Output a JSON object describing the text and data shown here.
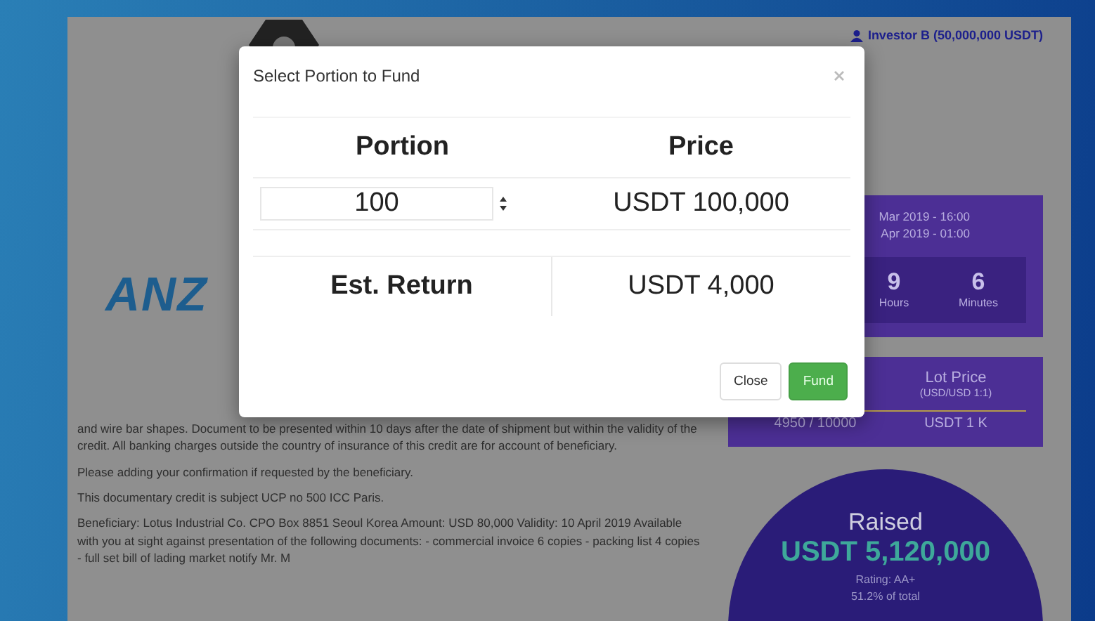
{
  "header": {
    "user": "Investor B (50,000,000 USDT)"
  },
  "logo": {
    "text": "ANZ"
  },
  "description": [
    "and wire bar shapes. Document to be presented within 10 days after the date of shipment but within the validity of the credit. All banking charges outside the country of insurance of this credit are for account of beneficiary.",
    "Please adding your confirmation if requested by the beneficiary.",
    "This documentary credit is subject UCP no 500 ICC Paris.",
    "Beneficiary: Lotus Industrial Co. CPO Box 8851 Seoul Korea Amount: USD 80,000 Validity: 10 April 2019 Available with you at sight against presentation of the following documents: - commercial invoice 6 copies - packing list 4 copies - full set bill of lading market notify Mr. M"
  ],
  "schedule": {
    "dates": [
      "Mar 2019 - 16:00",
      "Apr 2019 - 01:00"
    ],
    "countdown": [
      {
        "value": "9",
        "unit": "Hours"
      },
      {
        "value": "6",
        "unit": "Minutes"
      }
    ]
  },
  "lots": {
    "price_label": "Lot Price",
    "price_note": "(USD/USD 1:1)",
    "sold": "4950 / 10000",
    "price": "USDT 1 K"
  },
  "raised": {
    "label": "Raised",
    "amount": "USDT 5,120,000",
    "rating": "Rating: AA+",
    "share": "51.2% of total"
  },
  "modal": {
    "title": "Select Portion to Fund",
    "headers": [
      "Portion",
      "Price"
    ],
    "portion": "100",
    "price": "USDT 100,000",
    "return_label": "Est. Return",
    "return_value": "USDT 4,000",
    "buttons": [
      {
        "label": "Close",
        "kind": "default"
      },
      {
        "label": "Fund",
        "kind": "primary"
      }
    ]
  }
}
